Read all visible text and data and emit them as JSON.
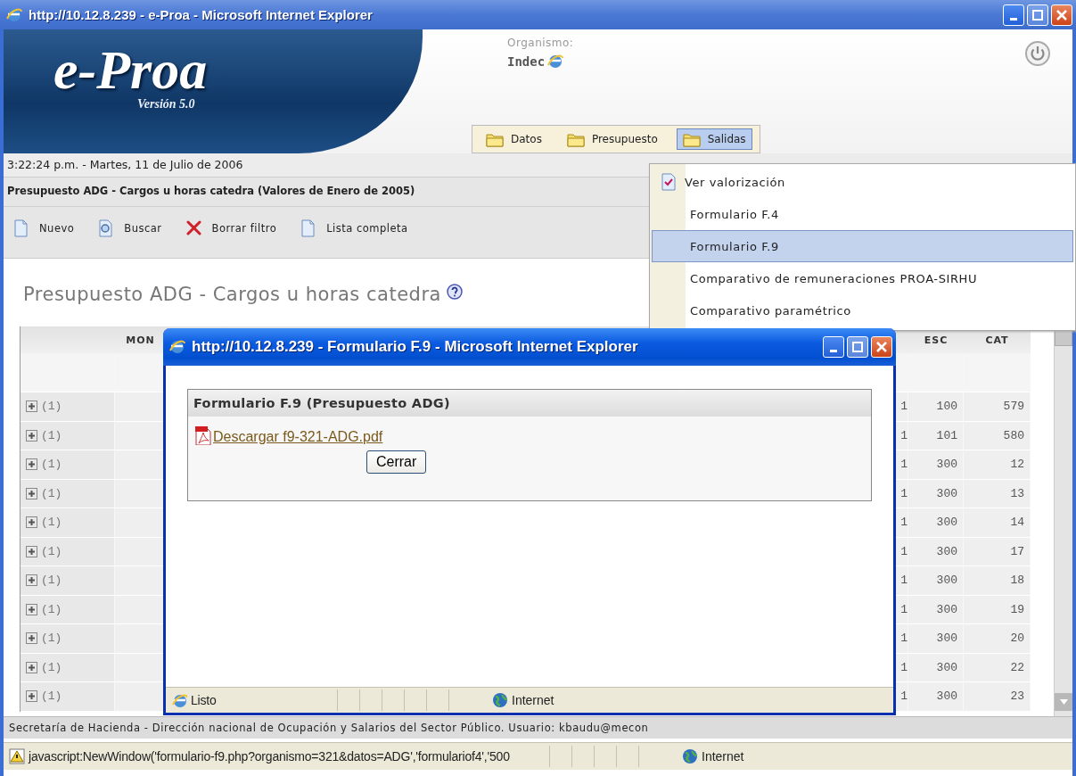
{
  "window": {
    "title": "http://10.12.8.239 - e-Proa - Microsoft Internet Explorer"
  },
  "header": {
    "logo": "e-Proa",
    "version": "Versión 5.0",
    "organismo_label": "Organismo:",
    "organismo": "Indec"
  },
  "menu_bar": [
    {
      "label": "Datos",
      "selected": false
    },
    {
      "label": "Presupuesto",
      "selected": false
    },
    {
      "label": "Salidas",
      "selected": true
    }
  ],
  "menu": [
    {
      "label": "Ver valorización",
      "checked": true,
      "selected": false
    },
    {
      "label": "Formulario F.4",
      "checked": false,
      "selected": false
    },
    {
      "label": "Formulario F.9",
      "checked": false,
      "selected": true
    },
    {
      "label": "Comparativo de remuneraciones PROA-SIRHU",
      "checked": false,
      "selected": false
    },
    {
      "label": "Comparativo paramétrico",
      "checked": false,
      "selected": false
    }
  ],
  "clock": "3:22:24 p.m. - Martes, 11 de Julio de 2006",
  "page_title": "Presupuesto ADG - Cargos u horas catedra (Valores de Enero de 2005)",
  "toolbar": [
    {
      "label": "Nuevo",
      "kind": "new"
    },
    {
      "label": "Buscar",
      "kind": "search"
    },
    {
      "label": "Borrar filtro",
      "kind": "clear"
    },
    {
      "label": "Lista completa",
      "kind": "list"
    }
  ],
  "heading": "Presupuesto ADG - Cargos u horas catedra",
  "table": {
    "columns": [
      "MON",
      "ESC",
      "CAT"
    ],
    "rows": [
      {
        "count": "(1)",
        "expanded": false,
        "column_3": "1",
        "esc": "100",
        "cat": "579"
      },
      {
        "count": "(1)",
        "expanded": false,
        "column_3": "1",
        "esc": "101",
        "cat": "580"
      },
      {
        "count": "(1)",
        "expanded": false,
        "column_3": "1",
        "esc": "300",
        "cat": "12"
      },
      {
        "count": "(1)",
        "expanded": false,
        "column_3": "1",
        "esc": "300",
        "cat": "13"
      },
      {
        "count": "(1)",
        "expanded": false,
        "column_3": "1",
        "esc": "300",
        "cat": "14"
      },
      {
        "count": "(1)",
        "expanded": false,
        "column_3": "1",
        "esc": "300",
        "cat": "17"
      },
      {
        "count": "(1)",
        "expanded": false,
        "column_3": "1",
        "esc": "300",
        "cat": "18"
      },
      {
        "count": "(1)",
        "expanded": false,
        "column_3": "1",
        "esc": "300",
        "cat": "19"
      },
      {
        "count": "(1)",
        "expanded": false,
        "column_3": "1",
        "esc": "300",
        "cat": "20"
      },
      {
        "count": "(1)",
        "expanded": false,
        "column_3": "1",
        "esc": "300",
        "cat": "22"
      },
      {
        "count": "(1)",
        "expanded": false,
        "column_3": "1",
        "esc": "300",
        "cat": "23"
      }
    ]
  },
  "footer": "Secretaría de Hacienda - Dirección nacional de Ocupación y Salarios del Sector Público. Usuario: kbaudu@mecon",
  "status_bar": {
    "text": "javascript:NewWindow('formulario-f9.php?organismo=321&datos=ADG','formulariof4','500",
    "zone": "Internet"
  },
  "popup": {
    "title": "http://10.12.8.239 - Formulario F.9 - Microsoft Internet Explorer",
    "panel_title": "Formulario F.9 (Presupuesto ADG)",
    "link": "Descargar f9-321-ADG.pdf",
    "button": "Cerrar",
    "status": "Listo",
    "zone": "Internet"
  }
}
